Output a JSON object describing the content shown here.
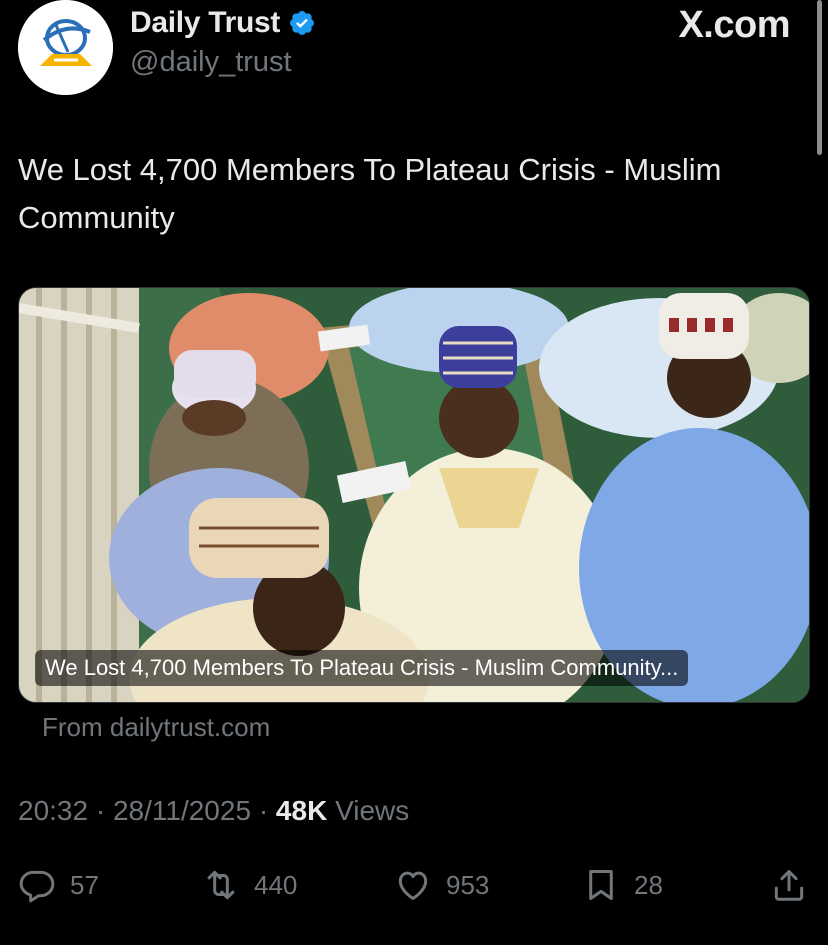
{
  "header": {
    "display_name": "Daily Trust",
    "handle": "@daily_trust",
    "brand": "X.com"
  },
  "tweet": {
    "text": "We Lost 4,700 Members To Plateau Crisis - Muslim Community"
  },
  "card": {
    "caption": "We Lost 4,700 Members To Plateau Crisis - Muslim Community...",
    "source": "From dailytrust.com"
  },
  "meta": {
    "time": "20:32",
    "date": "28/11/2025",
    "views_count": "48K",
    "views_label": "Views"
  },
  "actions": {
    "replies": "57",
    "reposts": "440",
    "likes": "953",
    "bookmarks": "28"
  },
  "colors": {
    "background": "#000000",
    "text_primary": "#e7e9ea",
    "text_secondary": "#71767b",
    "verified_blue": "#1d9bf0"
  },
  "icons": [
    "verified-badge-icon",
    "reply-icon",
    "repost-icon",
    "like-icon",
    "bookmark-icon",
    "share-icon"
  ]
}
